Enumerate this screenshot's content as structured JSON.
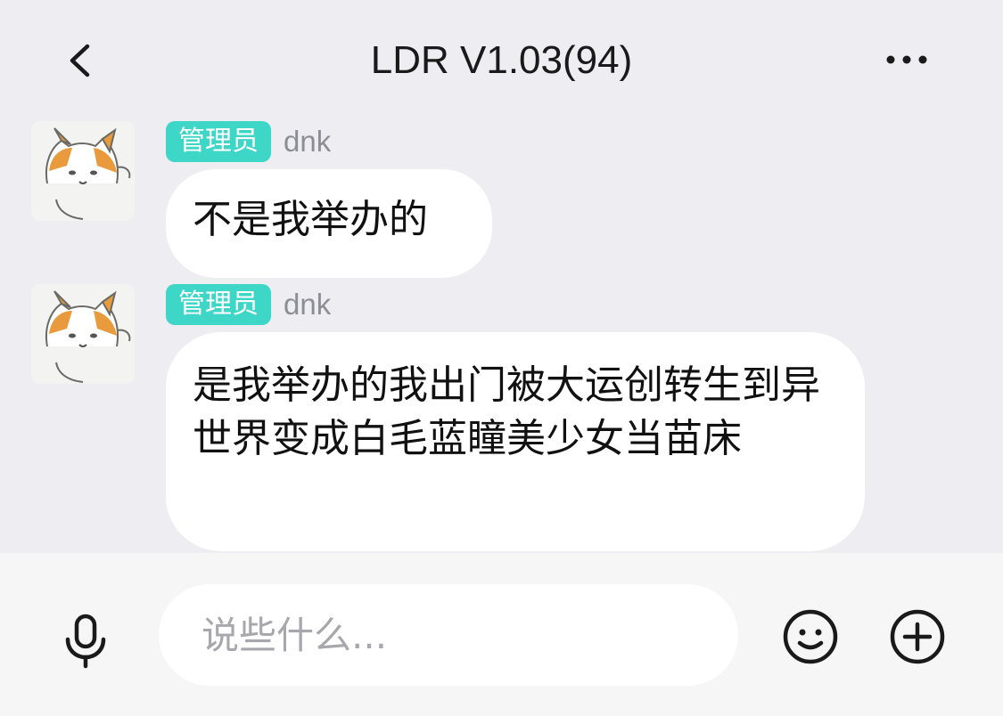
{
  "header": {
    "title": "LDR V1.03(94)",
    "back_icon": "chevron-left-icon",
    "more_icon": "more-horizontal-icon"
  },
  "messages": [
    {
      "role_badge": "管理员",
      "sender": "dnk",
      "text": "不是我举办的",
      "avatar": "cat-avatar"
    },
    {
      "role_badge": "管理员",
      "sender": "dnk",
      "text": "是我举办的我出门被大运创转生到异世界变成白毛蓝瞳美少女当苗床",
      "avatar": "cat-avatar"
    }
  ],
  "input_bar": {
    "placeholder": "说些什么...",
    "value": "",
    "mic_icon": "microphone-icon",
    "emoji_icon": "smiley-icon",
    "plus_icon": "plus-circle-icon"
  },
  "colors": {
    "background": "#ededf2",
    "badge": "#3dd6c7",
    "bubble": "#ffffff",
    "input_bar": "#f6f6f7"
  }
}
